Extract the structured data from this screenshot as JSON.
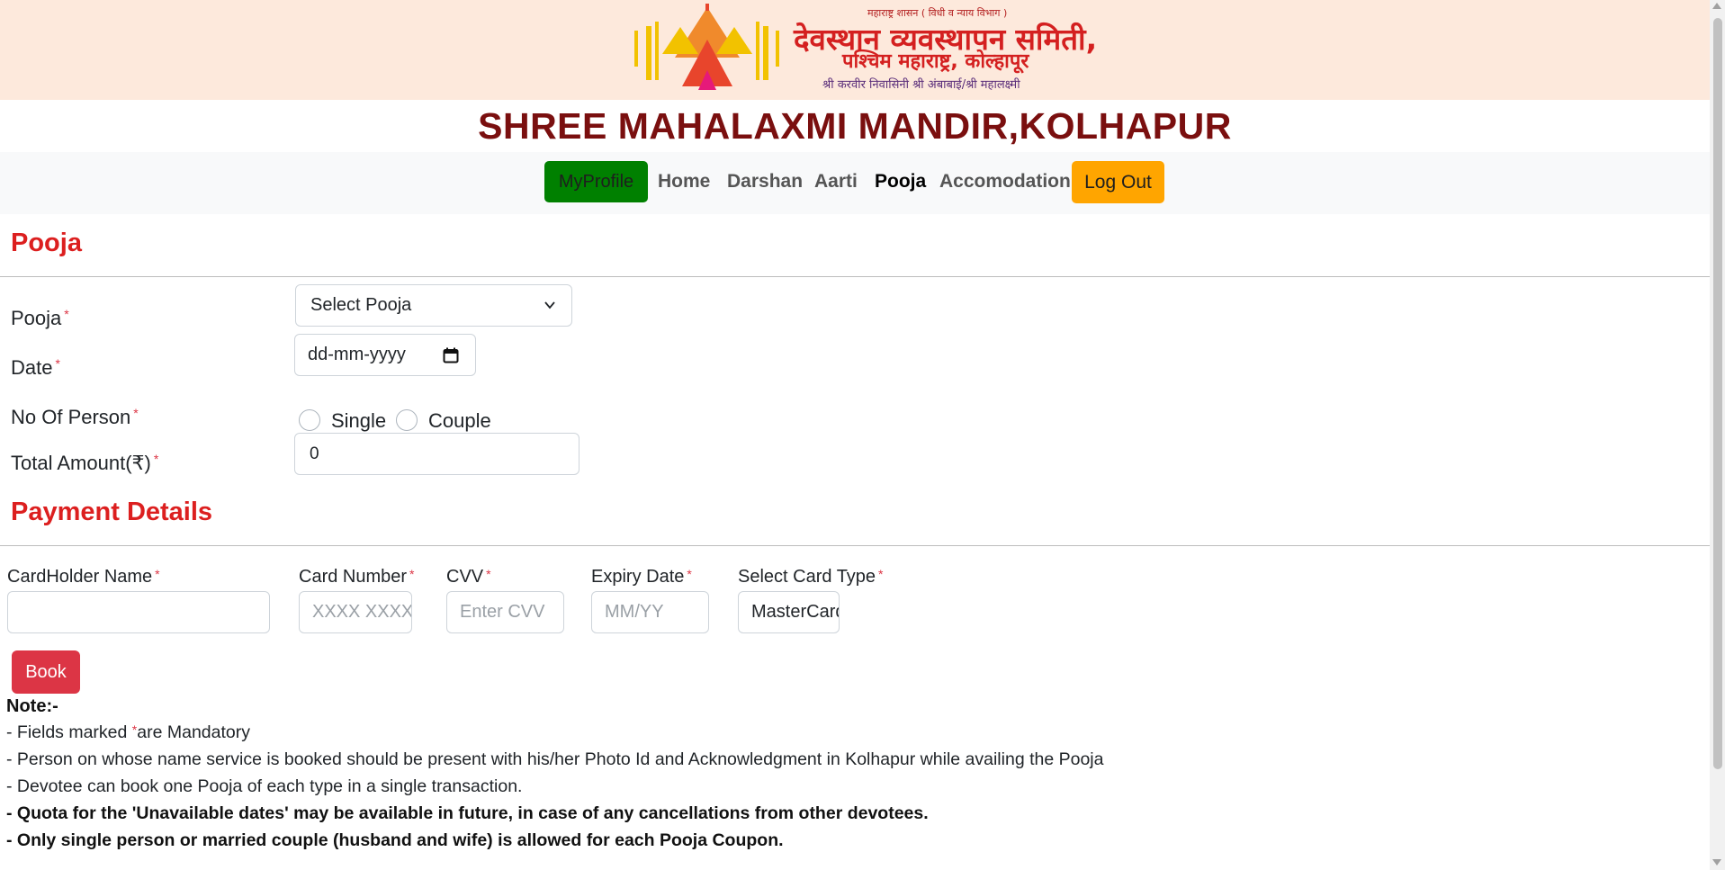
{
  "header": {
    "emblem_line1": "महाराष्ट्र शासन ( विधी व न्याय विभाग )",
    "emblem_line2": "देवस्थान व्यवस्थापन समिती,",
    "emblem_line3": "पश्चिम महाराष्ट्र, कोल्हापूर",
    "emblem_line4": "श्री करवीर निवासिनी श्री अंबाबाई/श्री महालक्ष्मी",
    "site_title": "SHREE MAHALAXMI MANDIR,KOLHAPUR"
  },
  "nav": {
    "my_profile": "MyProfile",
    "home": "Home",
    "darshan": "Darshan",
    "aarti": "Aarti",
    "pooja": "Pooja",
    "accomodation": "Accomodation",
    "logout": "Log Out",
    "active": "Pooja"
  },
  "form": {
    "section_title": "Pooja",
    "required_mark": "*",
    "pooja_label": "Pooja",
    "pooja_select_value": "Select Pooja",
    "date_label": "Date",
    "date_value": "dd-mm-yyyy",
    "persons_label": "No Of Person",
    "option_single": "Single",
    "option_couple": "Couple",
    "amount_label": "Total Amount(₹)",
    "amount_value": "0"
  },
  "payment": {
    "section_title": "Payment Details",
    "cardholder_label": "CardHolder Name",
    "cardholder_value": "",
    "card_number_label": "Card Number",
    "card_number_placeholder": "XXXX XXXX",
    "cvv_label": "CVV",
    "cvv_placeholder": "Enter CVV",
    "expiry_label": "Expiry Date",
    "expiry_placeholder": "MM/YY",
    "card_type_label": "Select Card Type",
    "card_type_value": "MasterCard",
    "book_button": "Book"
  },
  "notes": {
    "title": "Note:-",
    "line1_a": "- Fields marked ",
    "line1_b": "are Mandatory",
    "line2": "- Person on whose name service is booked should be present with his/her Photo Id and Acknowledgment in Kolhapur while availing the Pooja",
    "line3": "- Devotee can book one Pooja of each type in a single transaction.",
    "line4": "- Quota for the 'Unavailable dates' may be available in future, in case of any cancellations from other devotees.",
    "line5": "- Only single person or married couple (husband and wife) is allowed for each Pooja Coupon."
  },
  "colors": {
    "brand_red": "#dc1f1f",
    "title_maroon": "#7a0f0f",
    "profile_green": "#008000",
    "logout_orange": "#ffa500",
    "book_red": "#dc3545",
    "banner_bg": "#fde9dc"
  }
}
